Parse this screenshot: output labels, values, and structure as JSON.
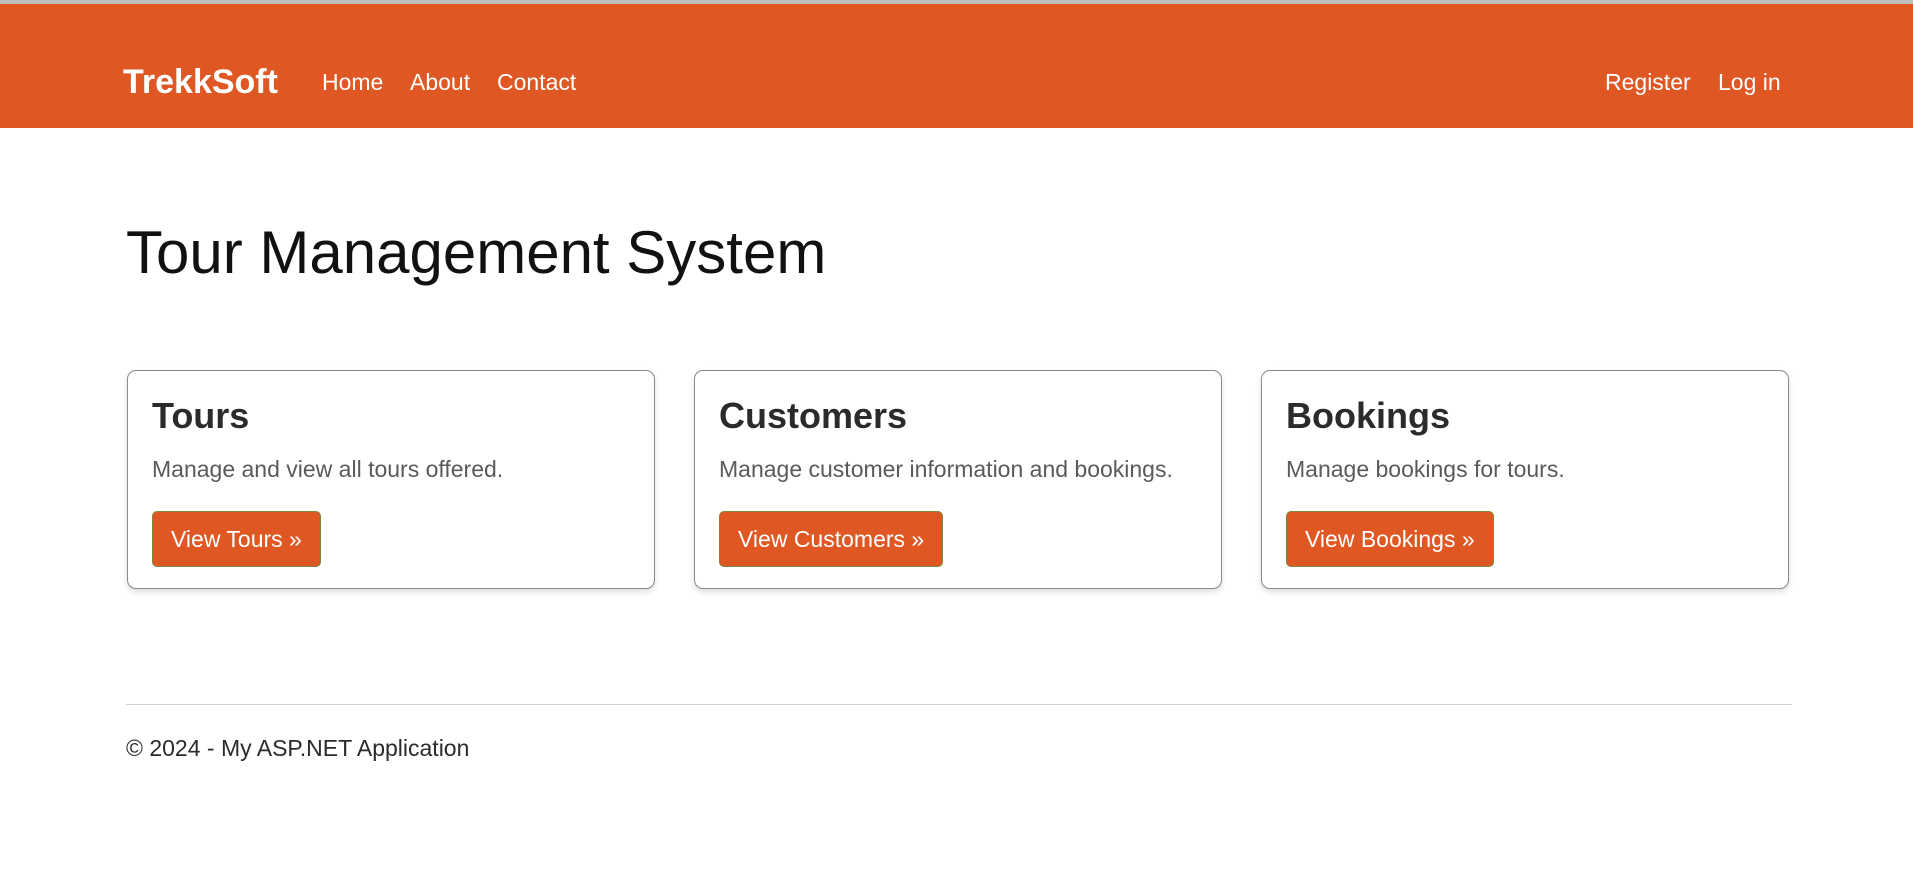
{
  "colors": {
    "brand_orange": "#df5824",
    "text_dark": "#2b2b2b",
    "text_muted": "#5a5a5a"
  },
  "navbar": {
    "brand": "TrekkSoft",
    "links": [
      {
        "label": "Home"
      },
      {
        "label": "About"
      },
      {
        "label": "Contact"
      }
    ],
    "auth": {
      "register": "Register",
      "login": "Log in"
    }
  },
  "main": {
    "title": "Tour Management System",
    "cards": [
      {
        "title": "Tours",
        "description": "Manage and view all tours offered.",
        "button": "View Tours »"
      },
      {
        "title": "Customers",
        "description": "Manage customer information and bookings.",
        "button": "View Customers »"
      },
      {
        "title": "Bookings",
        "description": "Manage bookings for tours.",
        "button": "View Bookings »"
      }
    ]
  },
  "footer": {
    "text": "© 2024 - My ASP.NET Application"
  }
}
